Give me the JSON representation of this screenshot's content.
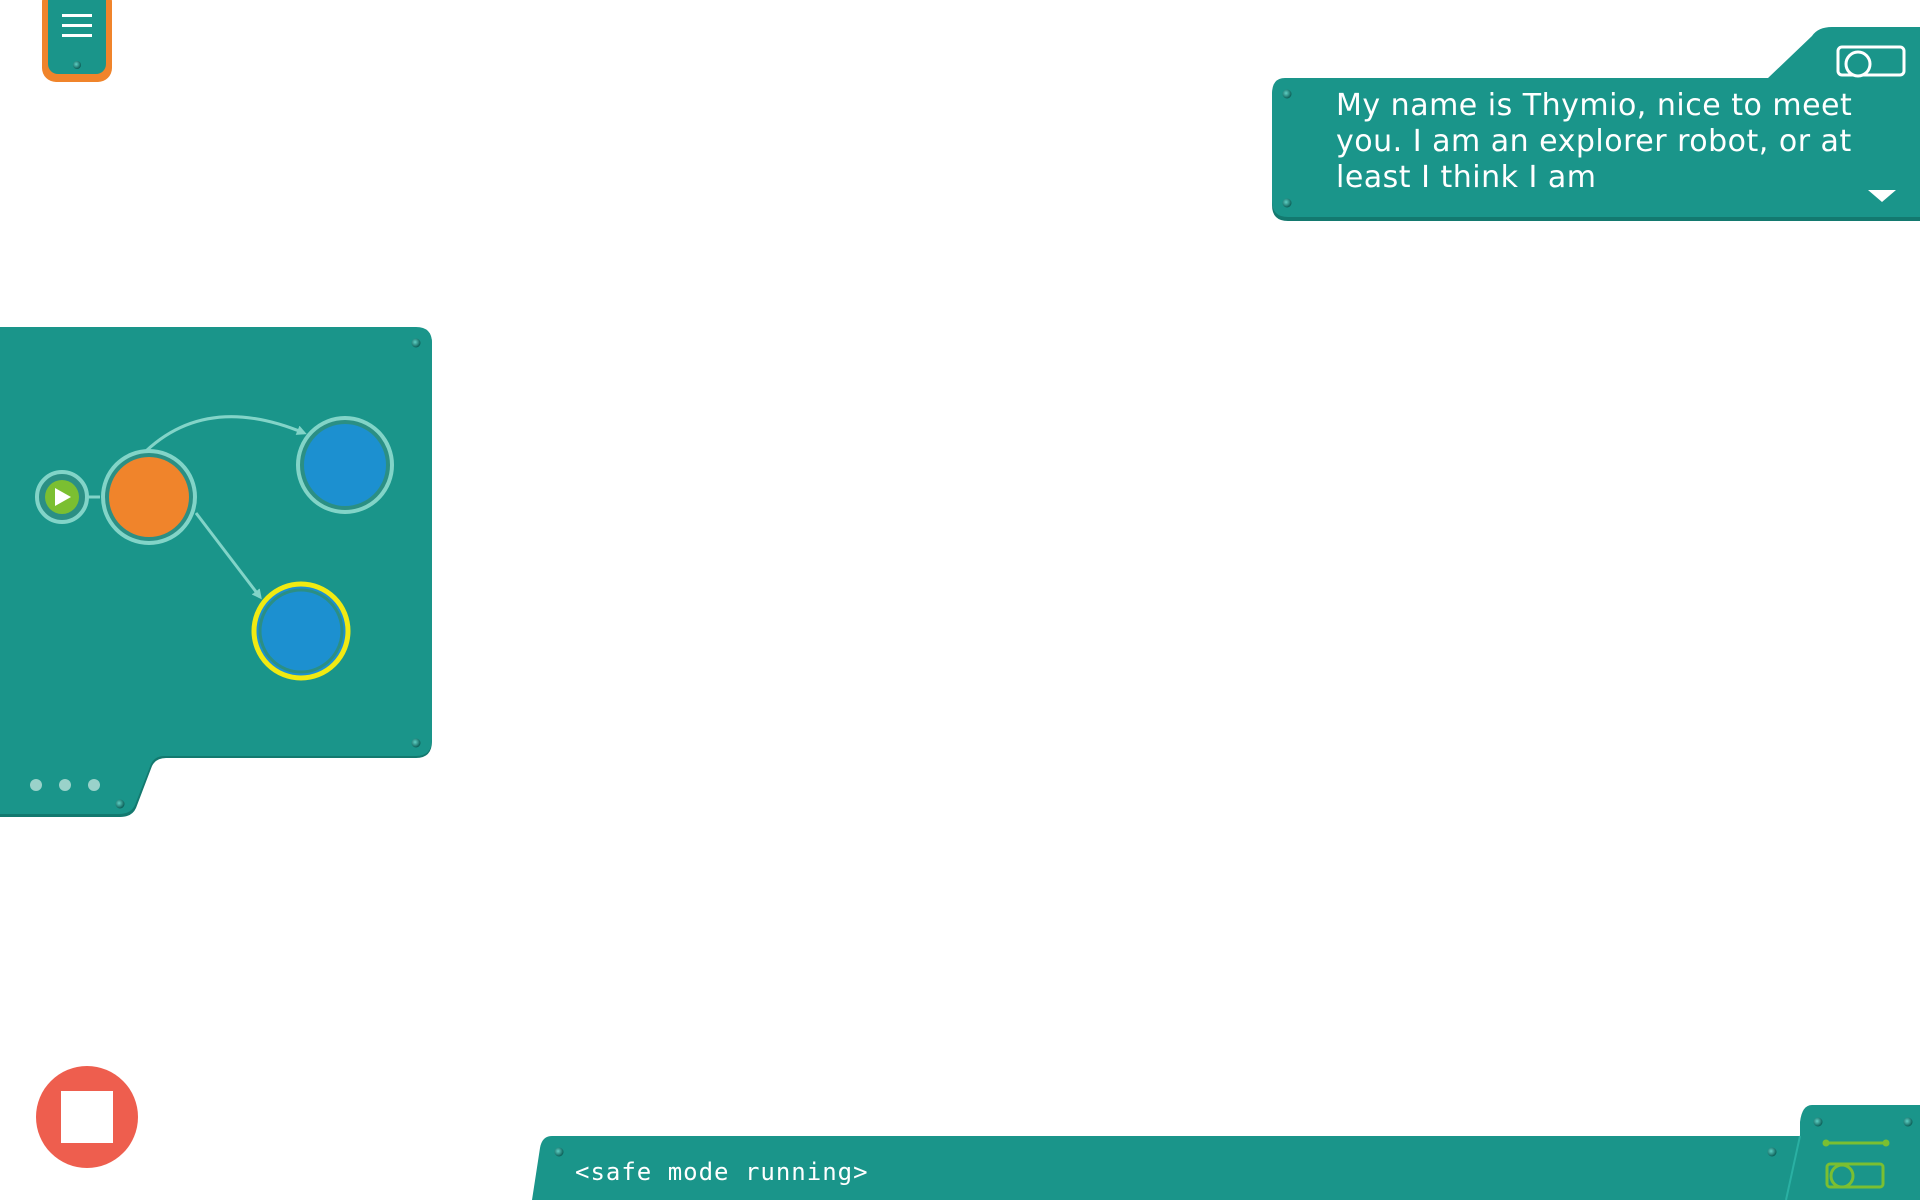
{
  "dialog": {
    "text": "My name is Thymio, nice to meet you. I am an explorer robot, or at least I think I am"
  },
  "console": {
    "text": "<safe mode running>"
  },
  "icons": {
    "menu": "hamburger-menu-icon",
    "camera": "camera-icon",
    "dialog_more": "chevron-down-icon",
    "stop": "stop-icon",
    "start": "play-icon",
    "panel_more": "ellipsis-icon",
    "console_camera": "camera-icon"
  },
  "colors": {
    "panel": "#1a958a",
    "panel_shadow": "#13796f",
    "accent_orange": "#f0842b",
    "state_blue": "#1c90d0",
    "node_ring": "#82d4c8",
    "selected_ring": "#f1ea12",
    "start_green": "#7bbf31",
    "stop_red": "#ee5e4e"
  },
  "state_graph": {
    "nodes": [
      {
        "id": "start",
        "kind": "start"
      },
      {
        "id": "state-orange",
        "kind": "state",
        "color": "orange",
        "active": true
      },
      {
        "id": "state-blue-top",
        "kind": "state",
        "color": "blue"
      },
      {
        "id": "state-blue-bottom",
        "kind": "state",
        "color": "blue",
        "selected": true
      }
    ],
    "edges": [
      {
        "from": "start",
        "to": "state-orange"
      },
      {
        "from": "state-orange",
        "to": "state-blue-top"
      },
      {
        "from": "state-orange",
        "to": "state-blue-bottom"
      }
    ]
  }
}
